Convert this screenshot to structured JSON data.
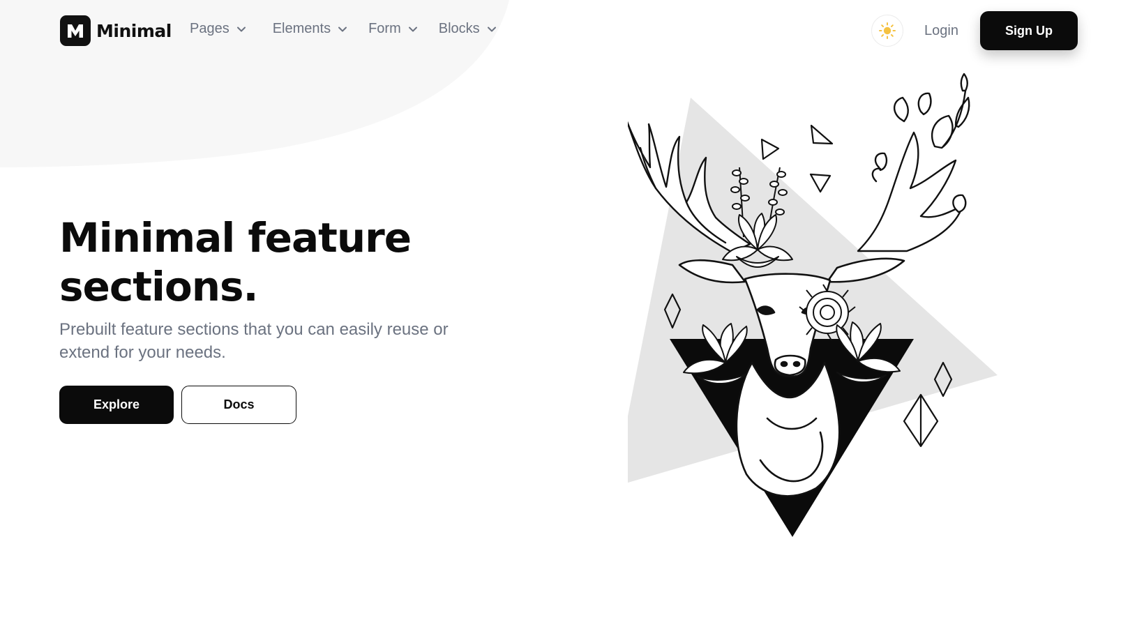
{
  "brand": {
    "name": "Minimal",
    "mark_letter": "M"
  },
  "nav": {
    "items": [
      {
        "label": "Pages",
        "icon": "chevron-down-icon"
      },
      {
        "label": "Elements",
        "icon": "chevron-down-icon"
      },
      {
        "label": "Form",
        "icon": "chevron-down-icon"
      },
      {
        "label": "Blocks",
        "icon": "chevron-down-icon"
      }
    ]
  },
  "header_actions": {
    "theme_icon": "sun-icon",
    "login_label": "Login",
    "signup_label": "Sign Up"
  },
  "hero": {
    "title_line1": "Minimal feature",
    "title_line2": "sections.",
    "subtitle": "Prebuilt feature sections that you can easily reuse or extend for your needs.",
    "primary_button": "Explore",
    "secondary_button": "Docs"
  },
  "illustration": {
    "subject": "deer-head-with-flowers-illustration"
  },
  "colors": {
    "text_dark": "#0b0b0b",
    "text_muted": "#6b7280",
    "blob": "#f7f7f7",
    "triangle_light": "#e5e5e5",
    "sun": "#f5c242"
  }
}
